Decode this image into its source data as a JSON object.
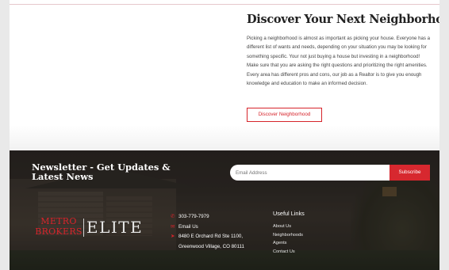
{
  "neighborhood": {
    "heading": "Discover Your Next Neighborhood",
    "paragraph": "Picking a neighborhood is almost as important as picking your house. Everyone has a different list of wants and needs, depending on your situation you may be looking for something specific. Your not just buying a house but investing in a neighborhood! Make sure that you are asking the right questions and prioritizing the right amenities. Every area has different pros and cons, our job as a Realtor is to give you enough knowledge and education to make an informed decision.",
    "cta_label": "Discover Neighborhood"
  },
  "newsletter": {
    "title_line1": "Newsletter - Get Updates &",
    "title_line2": "Latest News",
    "email_placeholder": "Email Address",
    "subscribe_label": "Subscribe"
  },
  "logo": {
    "metro": "METRO",
    "brokers": "BROKERS",
    "elite": "ELITE"
  },
  "contact": {
    "phone": "303-779-7979",
    "email_label": "Email Us",
    "address_line1": "8480 E Orchard Rd Ste 1100,",
    "address_line2": "Greenwood Village, CO 80111",
    "icons": [
      "phone-icon",
      "envelope-icon",
      "location-arrow-icon"
    ]
  },
  "useful_links": {
    "heading": "Useful Links",
    "items": [
      "About Us",
      "Neighborhoods",
      "Agents",
      "Contact Us"
    ]
  },
  "colors": {
    "accent": "#d6242b",
    "heading_text": "#222222",
    "footer_bg": "#2f2a25"
  }
}
